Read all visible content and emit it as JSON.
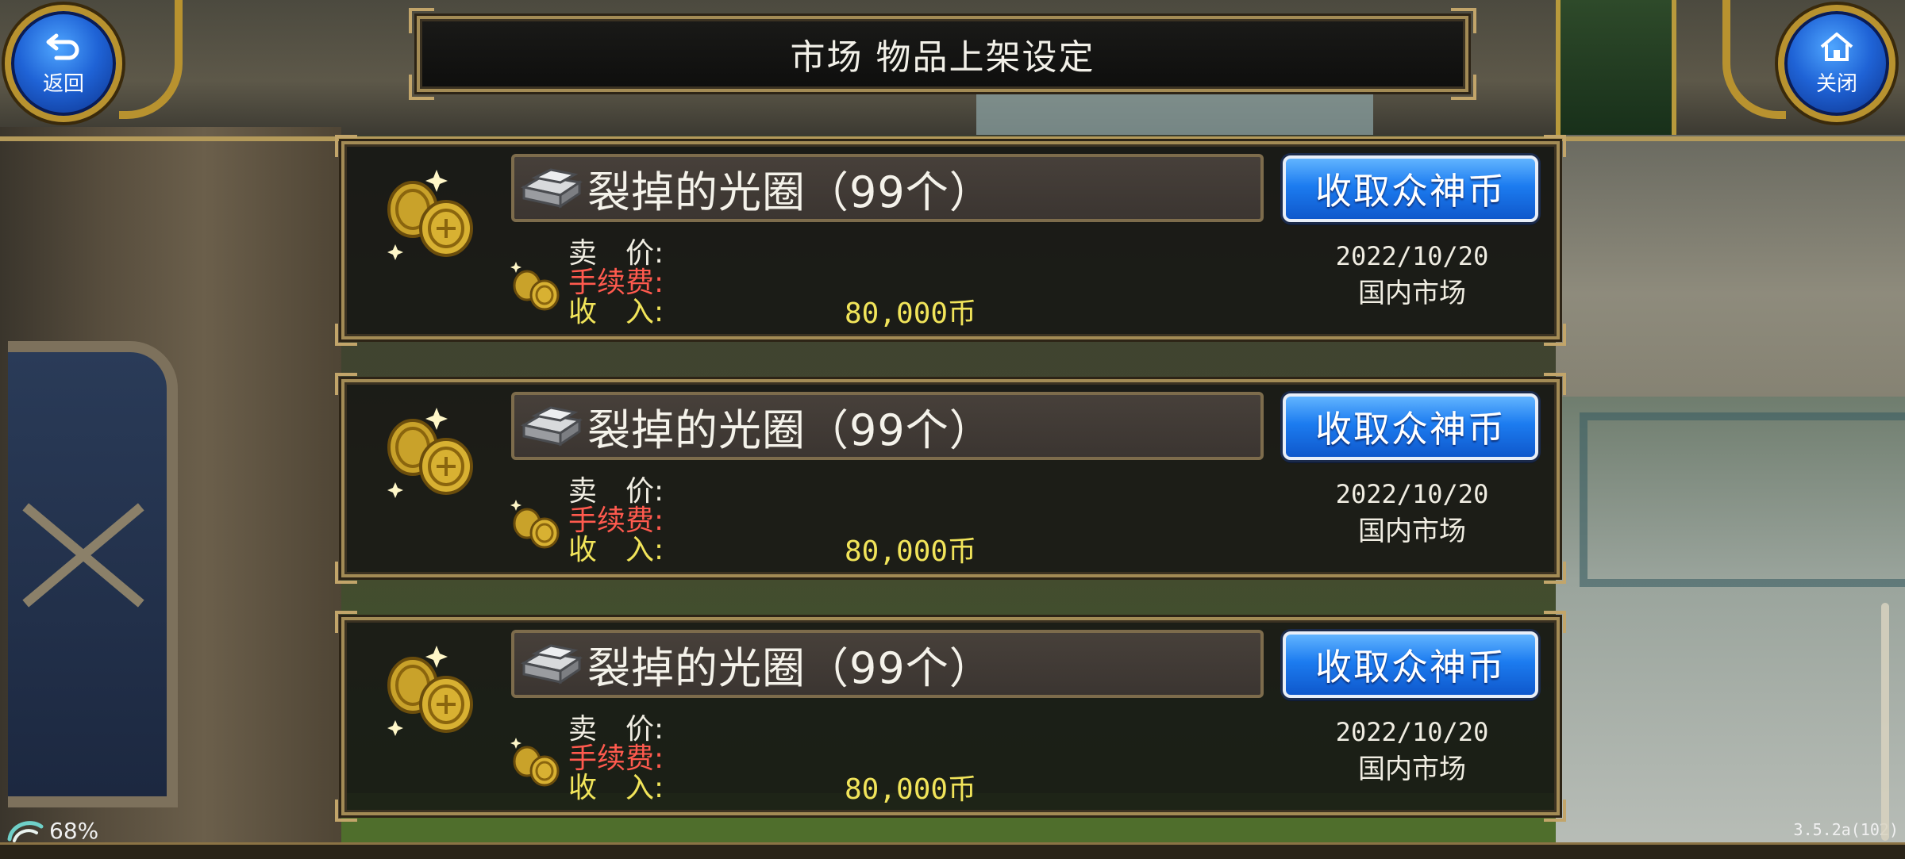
{
  "header": {
    "title": "市场  物品上架设定",
    "back_label": "返回",
    "close_label": "关闭"
  },
  "labels": {
    "price": "卖　价:",
    "fee": "手续费:",
    "income": "收　入:"
  },
  "listings": [
    {
      "item_name": "裂掉的光圈（99个）",
      "button_label": "收取众神币",
      "income": "80,000币",
      "date": "2022/10/20",
      "market": "国内市场"
    },
    {
      "item_name": "裂掉的光圈（99个）",
      "button_label": "收取众神币",
      "income": "80,000币",
      "date": "2022/10/20",
      "market": "国内市场"
    },
    {
      "item_name": "裂掉的光圈（99个）",
      "button_label": "收取众神币",
      "income": "80,000币",
      "date": "2022/10/20",
      "market": "国内市场"
    }
  ],
  "status": {
    "battery": "68%",
    "version": "3.5.2a(102)"
  },
  "icons": {
    "back": "back-arrow-icon",
    "close": "home-icon",
    "coins": "gold-coins-icon",
    "item": "silver-ingot-icon",
    "battery": "battery-swirl-icon"
  },
  "colors": {
    "fee_label": "#ff5a4e",
    "income": "#f1e45a",
    "button_blue": "#1c7cf0",
    "frame_gold": "#a38b55"
  }
}
